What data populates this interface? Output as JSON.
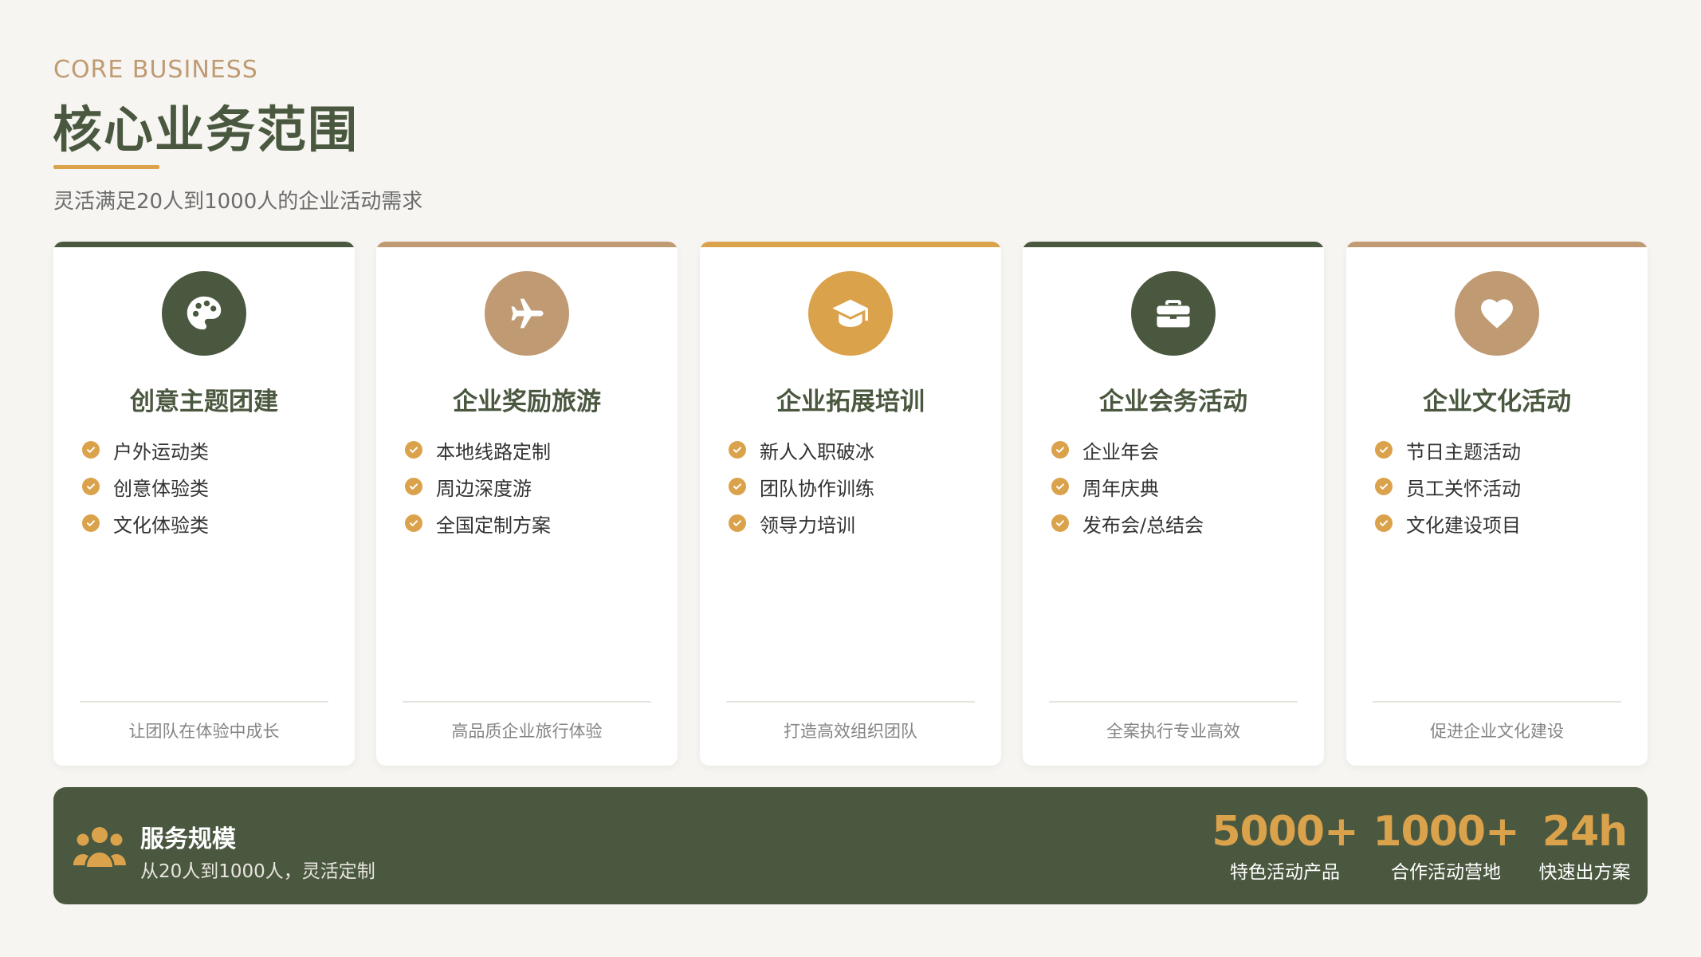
{
  "header": {
    "eyebrow": "CORE BUSINESS",
    "title": "核心业务范围",
    "subtitle": "灵活满足20人到1000人的企业活动需求"
  },
  "colors": {
    "primary_green": "#4b5840",
    "tan": "#bf9a73",
    "gold": "#dba24c"
  },
  "cards": [
    {
      "icon": "palette-icon",
      "accent": "#4b5840",
      "title": "创意主题团建",
      "items": [
        "户外运动类",
        "创意体验类",
        "文化体验类"
      ],
      "footer": "让团队在体验中成长"
    },
    {
      "icon": "airplane-icon",
      "accent": "#bf9a73",
      "title": "企业奖励旅游",
      "items": [
        "本地线路定制",
        "周边深度游",
        "全国定制方案"
      ],
      "footer": "高品质企业旅行体验"
    },
    {
      "icon": "graduation-cap-icon",
      "accent": "#dba24c",
      "title": "企业拓展培训",
      "items": [
        "新人入职破冰",
        "团队协作训练",
        "领导力培训"
      ],
      "footer": "打造高效组织团队"
    },
    {
      "icon": "briefcase-icon",
      "accent": "#4b5840",
      "title": "企业会务活动",
      "items": [
        "企业年会",
        "周年庆典",
        "发布会/总结会"
      ],
      "footer": "全案执行专业高效"
    },
    {
      "icon": "heart-icon",
      "accent": "#bf9a73",
      "title": "企业文化活动",
      "items": [
        "节日主题活动",
        "员工关怀活动",
        "文化建设项目"
      ],
      "footer": "促进企业文化建设"
    }
  ],
  "banner": {
    "icon": "people-icon",
    "title": "服务规模",
    "subtitle": "从20人到1000人，灵活定制",
    "stats": [
      {
        "value": "5000+",
        "label": "特色活动产品"
      },
      {
        "value": "1000+",
        "label": "合作活动营地"
      },
      {
        "value": "24h",
        "label": "快速出方案"
      }
    ]
  }
}
